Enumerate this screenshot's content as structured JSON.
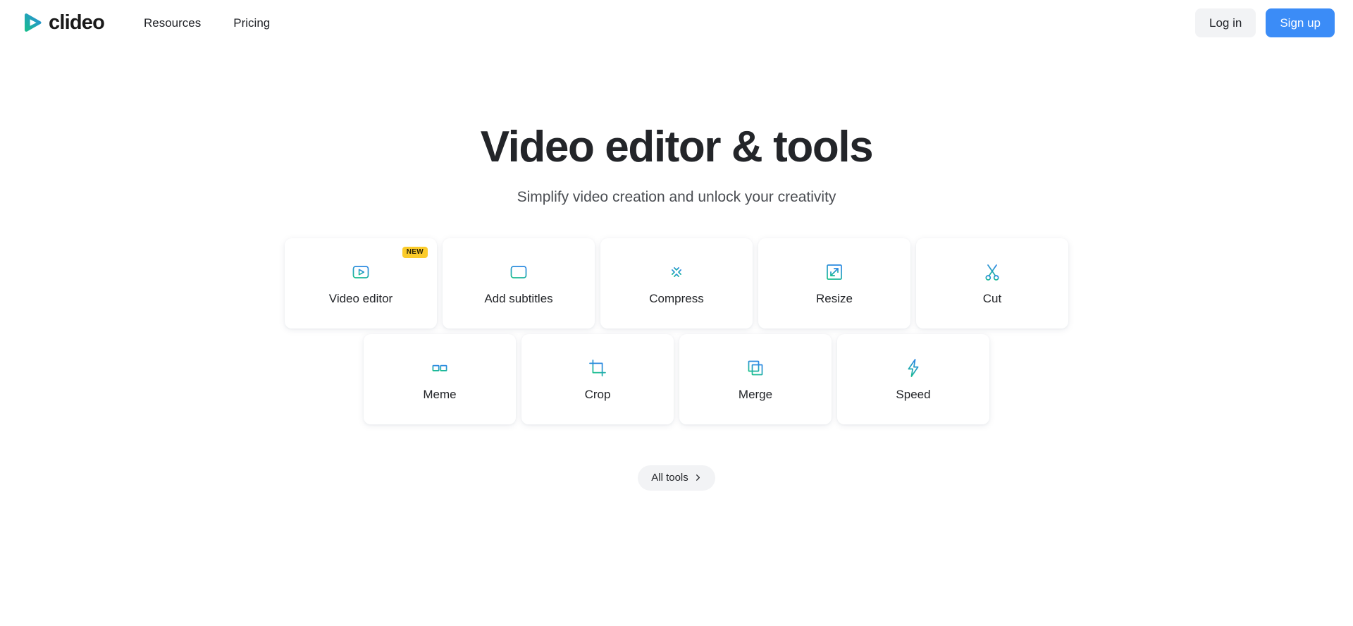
{
  "header": {
    "logo": {
      "text": "clideo",
      "icon": "play-logo-icon"
    },
    "nav": [
      {
        "label": "Resources"
      },
      {
        "label": "Pricing"
      }
    ],
    "login_label": "Log in",
    "signup_label": "Sign up"
  },
  "hero": {
    "title": "Video editor & tools",
    "subtitle": "Simplify video creation and unlock your creativity"
  },
  "tools": {
    "row1": [
      {
        "label": "Video editor",
        "icon": "video-editor-icon",
        "badge": "NEW"
      },
      {
        "label": "Add subtitles",
        "icon": "subtitles-icon"
      },
      {
        "label": "Compress",
        "icon": "compress-icon"
      },
      {
        "label": "Resize",
        "icon": "resize-icon"
      },
      {
        "label": "Cut",
        "icon": "scissors-icon"
      }
    ],
    "row2": [
      {
        "label": "Meme",
        "icon": "glasses-icon"
      },
      {
        "label": "Crop",
        "icon": "crop-icon"
      },
      {
        "label": "Merge",
        "icon": "merge-icon"
      },
      {
        "label": "Speed",
        "icon": "lightning-icon"
      }
    ]
  },
  "all_tools": {
    "label": "All tools",
    "icon": "chevron-right-icon"
  },
  "colors": {
    "accent_blue": "#3b8cf7",
    "gradient_top": "#2b8ae0",
    "gradient_bottom": "#17c08a",
    "badge_yellow": "#fbcb2b",
    "text_dark": "#232529",
    "surface_gray": "#f2f3f5"
  }
}
